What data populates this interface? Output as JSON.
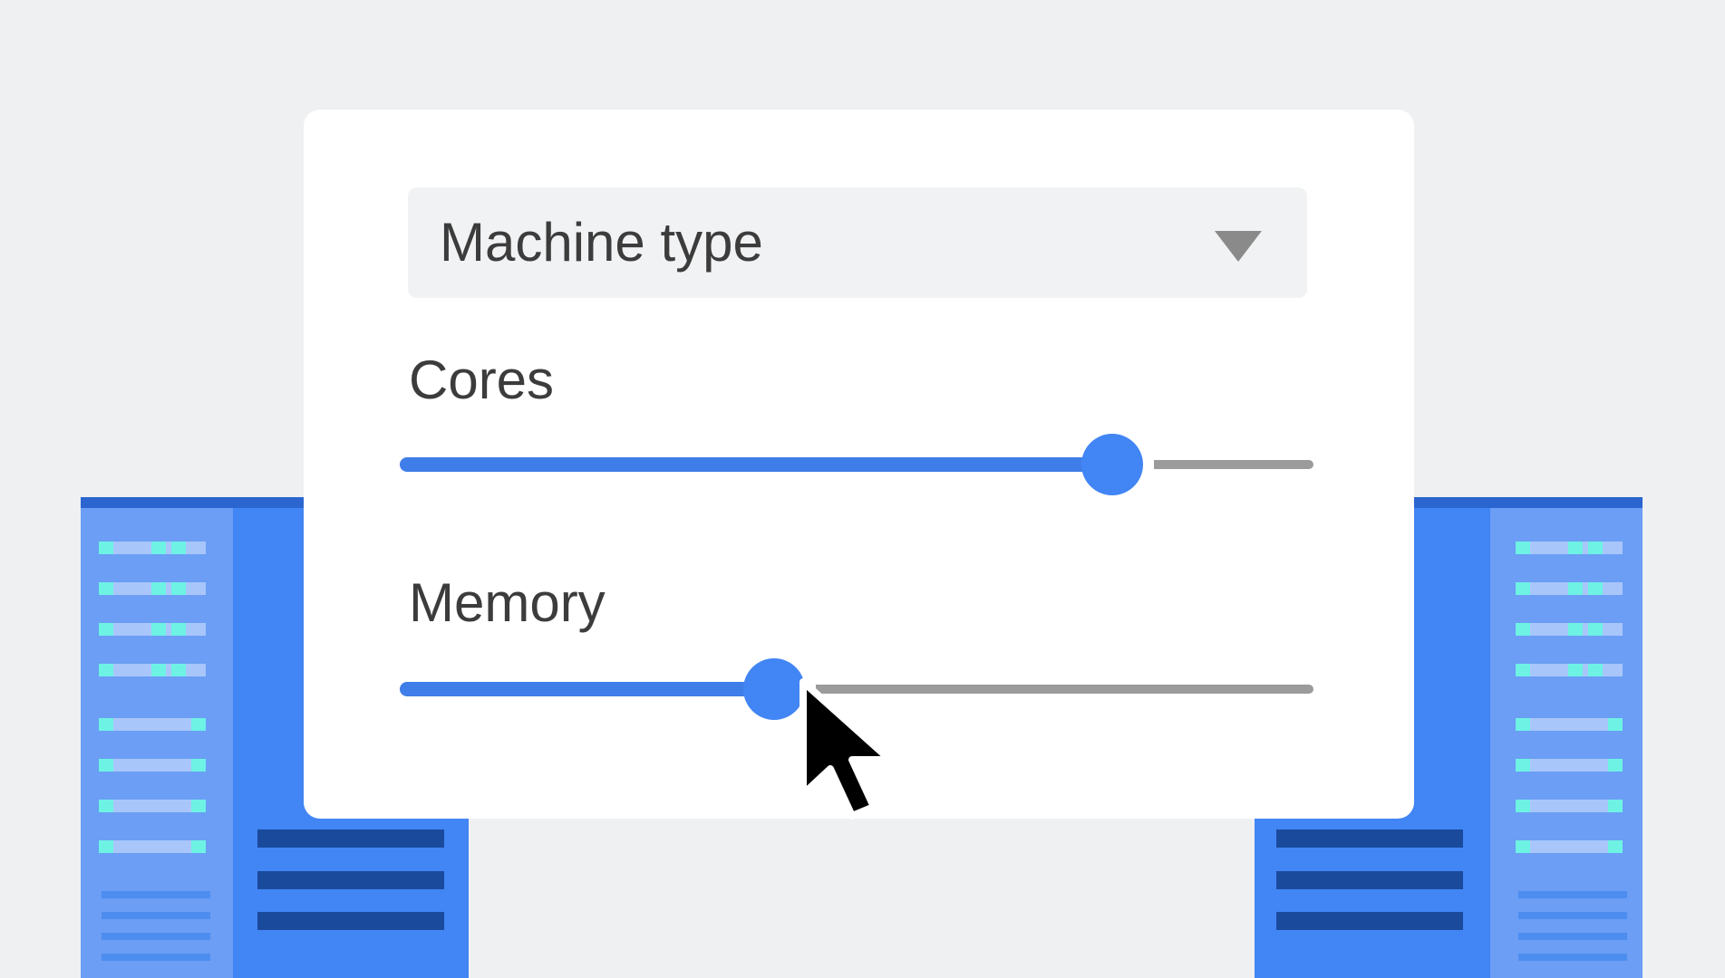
{
  "dropdown": {
    "label": "Machine type",
    "icon": "triangle-down-icon"
  },
  "cores": {
    "label": "Cores",
    "value_fraction": 0.78
  },
  "memory": {
    "label": "Memory",
    "value_fraction": 0.41
  },
  "colors": {
    "accent": "#4285f4",
    "track_inactive": "#9b9b9b",
    "background": "#eff0f2",
    "card": "#ffffff"
  },
  "pointer": {
    "icon": "cursor-arrow-icon"
  }
}
